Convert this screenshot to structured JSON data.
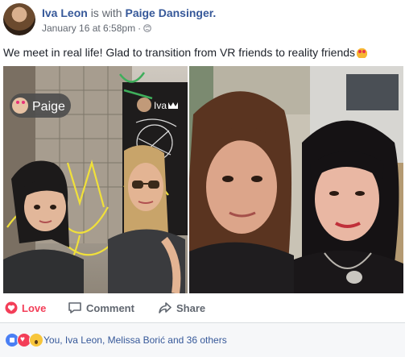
{
  "header": {
    "author": "Iva Leon",
    "with_text": "is with",
    "tagged": "Paige Dansinger.",
    "timestamp": "January 16 at 6:58pm",
    "separator": "·",
    "privacy_icon": "globe-icon"
  },
  "post": {
    "text": "We meet in real life! Glad to transition from VR friends to reality friends",
    "emoji": "smiling-cat-heart-eyes-emoji"
  },
  "photos": {
    "left": {
      "description": "vr-avatars",
      "name_tag_left": "Paige",
      "name_tag_right": "Iva"
    },
    "right": {
      "description": "selfie"
    }
  },
  "actions": {
    "love_label": "Love",
    "comment_label": "Comment",
    "share_label": "Share"
  },
  "reactions": {
    "types": [
      "like-icon",
      "love-icon",
      "wow-icon"
    ],
    "summary_text": "You, Iva Leon, Melissa Borić and 36 others"
  },
  "colors": {
    "link": "#365899",
    "love": "#f33e58",
    "muted": "#616770",
    "summary_bg": "#f6f7f9"
  }
}
